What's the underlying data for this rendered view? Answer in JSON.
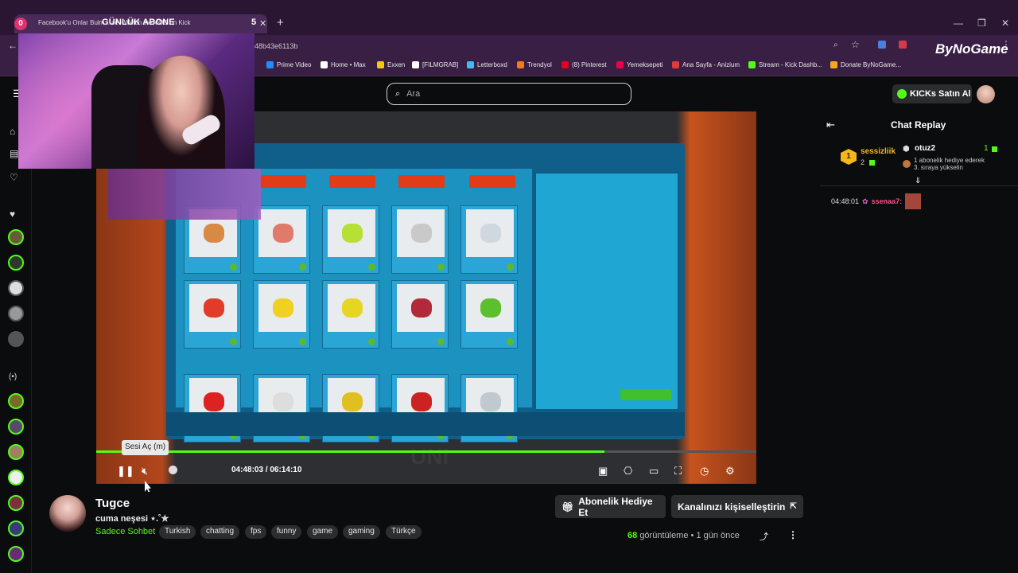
{
  "browser": {
    "tab_count": "0",
    "tab_title": "Facebook'u Onlar Bulm... ce - Watch the VOD on Kick",
    "url_fragment": "48b43e6113b",
    "profile_badge": "ByNoGame"
  },
  "overlay": {
    "label": "GÜNLÜK ABONE",
    "count": "5"
  },
  "bookmarks": [
    {
      "label": "Prime Video",
      "color": "#1f8fff"
    },
    {
      "label": "Home • Max",
      "color": "#ffffff"
    },
    {
      "label": "Exxen",
      "color": "#f5c518"
    },
    {
      "label": "[FILMGRAB]",
      "color": "#ffffff"
    },
    {
      "label": "Letterboxd",
      "color": "#40bcf4"
    },
    {
      "label": "Trendyol",
      "color": "#f27a1a"
    },
    {
      "label": "(8) Pinterest",
      "color": "#e60023"
    },
    {
      "label": "Yemeksepeti",
      "color": "#ea004b"
    },
    {
      "label": "Ana Sayfa - Anizium",
      "color": "#e03a3a"
    },
    {
      "label": "Stream - Kick Dashb...",
      "color": "#53fc18"
    },
    {
      "label": "Donate ByNoGame...",
      "color": "#f5a623"
    }
  ],
  "header": {
    "search_placeholder": "Ara",
    "kicks_button": "KICKs Satın Al"
  },
  "player": {
    "tooltip": "Sesi Aç (m)",
    "current_time": "04:48:03",
    "separator": "/",
    "duration": "06:14:10",
    "progress": 0.77,
    "watermark": "UNI"
  },
  "chat": {
    "title": "Chat Replay",
    "gifter_rank": "1",
    "gifter_name": "sessizliik",
    "gifter_count": "2",
    "gift_user": "otuz2",
    "gift_user_count": "1",
    "gift_text_1": "1 abonelik hediye ederek",
    "gift_text_2": "3. sıraya yükselin",
    "messages": [
      {
        "time": "04:48:01",
        "user": "ssenaa7:"
      }
    ]
  },
  "channel": {
    "name": "Tugce",
    "stream_title": "cuma neşesi ⋆.˚✮",
    "category": "Sadece Sohbet",
    "tags": [
      "Turkish",
      "chatting",
      "fps",
      "funny",
      "game",
      "gaming",
      "Türkçe"
    ],
    "gift_sub_button": "Abonelik Hediye Et",
    "customize_button": "Kanalınızı kişiselleştirin",
    "view_count": "68",
    "views_label": "görüntüleme",
    "time_ago": "1 gün önce"
  },
  "colors": {
    "accent": "#53fc18",
    "gold": "#f5b71b"
  }
}
